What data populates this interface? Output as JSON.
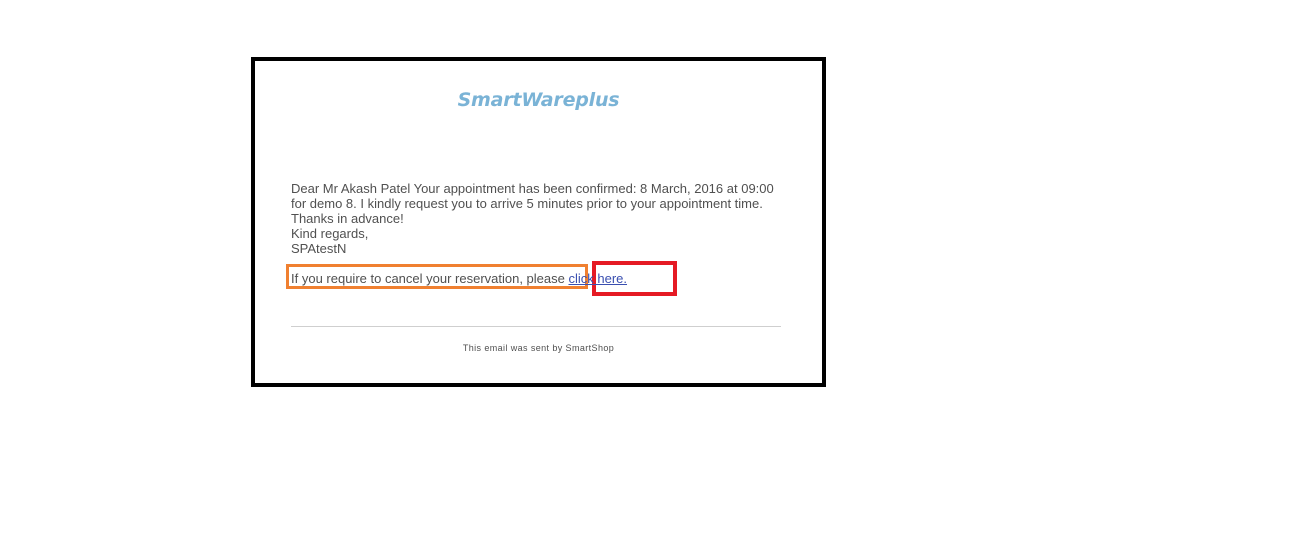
{
  "email": {
    "brand": "SmartWareplus",
    "message_lines": [
      "Dear Mr Akash Patel Your appointment has been confirmed: 8 March, 2016 at 09:00 for demo 8. I kindly request you to arrive 5 minutes prior to your appointment time. Thanks in advance!",
      "Kind regards,",
      "SPAtestN"
    ],
    "cancel_text": "If you require to cancel your reservation, please ",
    "cancel_link": "click here.",
    "footer": "This email was sent by SmartShop"
  },
  "colors": {
    "brand": "#7ab3d6",
    "link": "#3a4fb0",
    "highlight_orange": "#f08030",
    "highlight_red": "#e51a24",
    "frame_border": "#000000"
  }
}
